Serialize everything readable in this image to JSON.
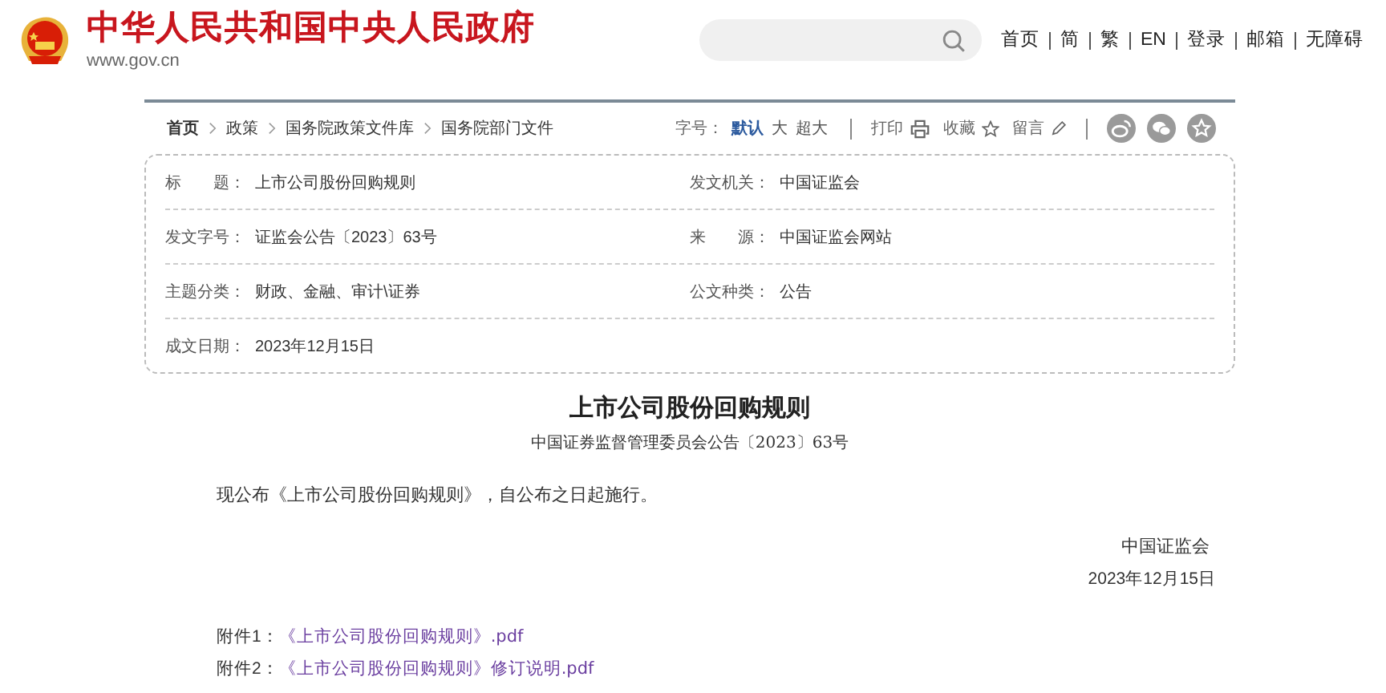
{
  "header": {
    "site_title": "中华人民共和国中央人民政府",
    "site_url": "www.gov.cn",
    "nav_links": [
      "首页",
      "简",
      "繁",
      "EN",
      "登录",
      "邮箱",
      "无障碍"
    ]
  },
  "breadcrumb": [
    "首页",
    "政策",
    "国务院政策文件库",
    "国务院部门文件"
  ],
  "font_size": {
    "label": "字号：",
    "options": [
      {
        "label": "默认",
        "selected": true
      },
      {
        "label": "大",
        "selected": false
      },
      {
        "label": "超大",
        "selected": false
      }
    ]
  },
  "tools": [
    {
      "kind": "print",
      "label": "打印"
    },
    {
      "kind": "favorite",
      "label": "收藏"
    },
    {
      "kind": "comment",
      "label": "留言"
    }
  ],
  "share_icons": [
    {
      "kind": "swirl"
    },
    {
      "kind": "chat"
    },
    {
      "kind": "star"
    }
  ],
  "info_rows": [
    [
      {
        "label": "标　　题：",
        "value": "上市公司股份回购规则"
      },
      {
        "label": "发文机关：",
        "value": "中国证监会"
      }
    ],
    [
      {
        "label": "发文字号：",
        "value": "证监会公告〔2023〕63号"
      },
      {
        "label": "来　　源：",
        "value": "中国证监会网站"
      }
    ],
    [
      {
        "label": "主题分类：",
        "value": "财政、金融、审计\\证券"
      },
      {
        "label": "公文种类：",
        "value": "公告"
      }
    ],
    [
      {
        "label": "成文日期：",
        "value": "2023年12月15日"
      }
    ]
  ],
  "article": {
    "title": "上市公司股份回购规则",
    "subtitle": "中国证券监督管理委员会公告〔2023〕63号",
    "paragraph": "现公布《上市公司股份回购规则》，自公布之日起施行。",
    "signature": "中国证监会",
    "date": "2023年12月15日",
    "attachments": [
      {
        "label": "附件1：",
        "link": "《上市公司股份回购规则》.pdf"
      },
      {
        "label": "附件2：",
        "link": "《上市公司股份回购规则》修订说明.pdf"
      }
    ]
  }
}
